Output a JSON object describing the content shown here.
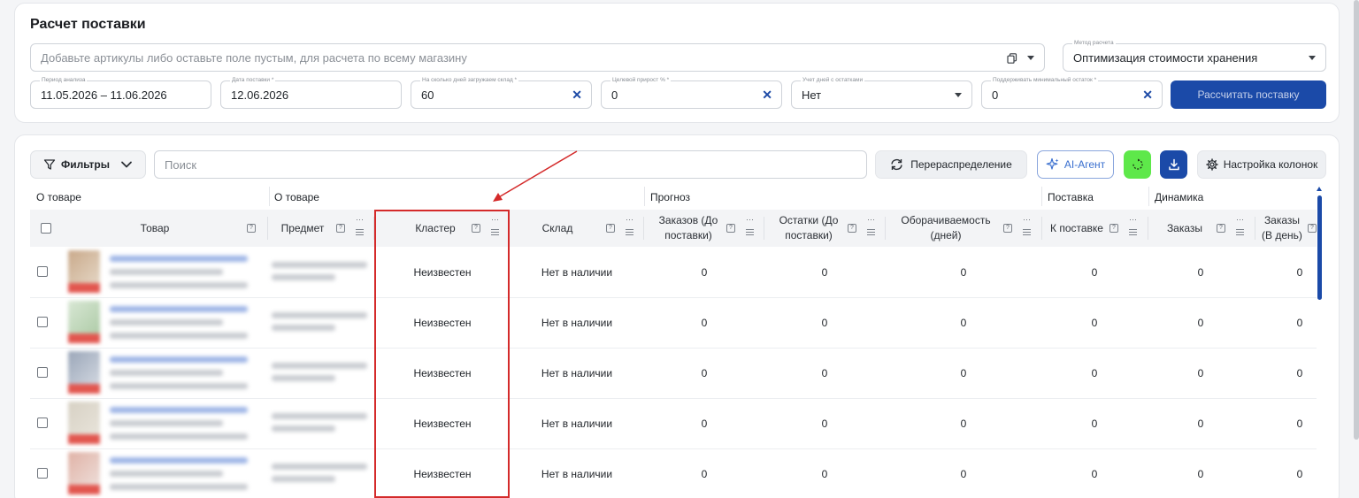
{
  "top": {
    "title": "Расчет поставки",
    "articles_placeholder": "Добавьте артикулы либо оставьте поле пустым, для расчета по всему магазину",
    "method": {
      "label": "Метод расчета",
      "value": "Оптимизация стоимости хранения"
    },
    "period": {
      "label": "Период анализа",
      "value": "11.05.2026 – 11.06.2026"
    },
    "delivery_date": {
      "label": "Дата поставки *",
      "value": "12.06.2026"
    },
    "days_load": {
      "label": "На сколько дней загружаем склад *",
      "value": "60"
    },
    "growth": {
      "label": "Целевой прирост % *",
      "value": "0"
    },
    "stock_days": {
      "label": "Учет дней с остатками",
      "value": "Нет"
    },
    "min_stock": {
      "label": "Поддерживать минимальный остаток *",
      "value": "0"
    },
    "calc_button": "Рассчитать поставку"
  },
  "toolbar": {
    "filters": "Фильтры",
    "search_placeholder": "Поиск",
    "redistribution": "Перераспределение",
    "ai_agent": "AI-Агент",
    "column_settings": "Настройка колонок"
  },
  "groups": [
    "О товаре",
    "О товаре",
    "Прогноз",
    "Поставка",
    "Динамика"
  ],
  "headers": {
    "product": "Товар",
    "subject": "Предмет",
    "cluster": "Кластер",
    "warehouse": "Склад",
    "orders_before": "Заказов (До поставки)",
    "stock_before": "Остатки (До поставки)",
    "turnover": "Оборачиваемость (дней)",
    "to_supply": "К поставке",
    "orders": "Заказы",
    "orders_per_day": "Заказы (В день)"
  },
  "help_mark": "?",
  "rows": [
    {
      "cluster": "Неизвестен",
      "warehouse": "Нет в наличии",
      "orders_before": "0",
      "stock_before": "0",
      "turnover": "0",
      "to_supply": "0",
      "orders": "0",
      "orders_per_day": "0"
    },
    {
      "cluster": "Неизвестен",
      "warehouse": "Нет в наличии",
      "orders_before": "0",
      "stock_before": "0",
      "turnover": "0",
      "to_supply": "0",
      "orders": "0",
      "orders_per_day": "0"
    },
    {
      "cluster": "Неизвестен",
      "warehouse": "Нет в наличии",
      "orders_before": "0",
      "stock_before": "0",
      "turnover": "0",
      "to_supply": "0",
      "orders": "0",
      "orders_per_day": "0"
    },
    {
      "cluster": "Неизвестен",
      "warehouse": "Нет в наличии",
      "orders_before": "0",
      "stock_before": "0",
      "turnover": "0",
      "to_supply": "0",
      "orders": "0",
      "orders_per_day": "0"
    },
    {
      "cluster": "Неизвестен",
      "warehouse": "Нет в наличии",
      "orders_before": "0",
      "stock_before": "0",
      "turnover": "0",
      "to_supply": "0",
      "orders": "0",
      "orders_per_day": "0"
    }
  ],
  "colors": {
    "accent": "#1b4aa8",
    "highlight": "#d42a2a",
    "refresh": "#5ee84a"
  }
}
